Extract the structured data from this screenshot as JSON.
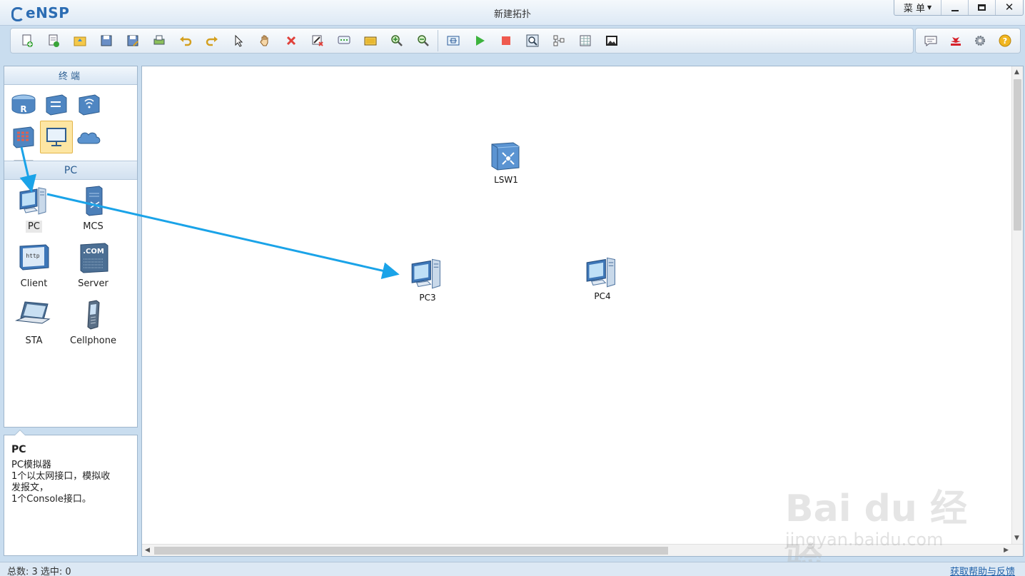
{
  "app": {
    "name": "eNSP",
    "window_title": "新建拓扑",
    "menu_label": "菜 单"
  },
  "toolbar": {
    "icons": [
      "new-topology-icon",
      "new-example-icon",
      "open-icon",
      "save-icon",
      "save-as-icon",
      "print-icon",
      "undo-icon",
      "redo-icon",
      "select-pointer-icon",
      "pan-hand-icon",
      "delete-icon",
      "delete-link-icon",
      "add-text-icon",
      "palette-icon",
      "zoom-in-icon",
      "zoom-out-icon",
      "fit-view-icon",
      "start-device-icon",
      "stop-device-icon",
      "capture-data-icon",
      "topology-icon",
      "grid-icon",
      "screenshot-icon"
    ],
    "right_icons": [
      "chat-icon",
      "huawei-logo-icon",
      "settings-gear-icon",
      "help-icon"
    ]
  },
  "left_panel": {
    "header": "终端",
    "categories": [
      "router-icon",
      "switch-icon",
      "wireless-icon",
      "firewall-icon",
      "end-device-icon",
      "cloud-icon",
      "link-icon"
    ],
    "selected_category": "end-device-icon",
    "group_header": "PC",
    "devices": [
      {
        "label": "PC",
        "icon": "pc-icon",
        "selected": true
      },
      {
        "label": "MCS",
        "icon": "mcs-server-icon",
        "selected": false
      },
      {
        "label": "Client",
        "icon": "http-client-icon",
        "selected": false
      },
      {
        "label": "Server",
        "icon": "com-server-icon",
        "selected": false
      },
      {
        "label": "STA",
        "icon": "laptop-sta-icon",
        "selected": false
      },
      {
        "label": "Cellphone",
        "icon": "cellphone-icon",
        "selected": false
      }
    ]
  },
  "description": {
    "title": "PC",
    "lines": [
      "PC模拟器",
      "1个以太网接口，模拟收",
      "发报文，",
      "1个Console接口。"
    ]
  },
  "canvas": {
    "nodes": [
      {
        "label": "LSW1",
        "type": "switch"
      },
      {
        "label": "PC3",
        "type": "pc"
      },
      {
        "label": "PC4",
        "type": "pc"
      }
    ]
  },
  "status": {
    "total": "总数: 3  选中: 0",
    "help_link": "获取帮助与反馈"
  },
  "watermark": {
    "brand": "Bai du 经验",
    "url": "jingyan.baidu.com"
  },
  "colors": {
    "accent": "#2b6cb3",
    "arrow": "#1aa3e8",
    "selected_bg": "#fde6a3"
  }
}
